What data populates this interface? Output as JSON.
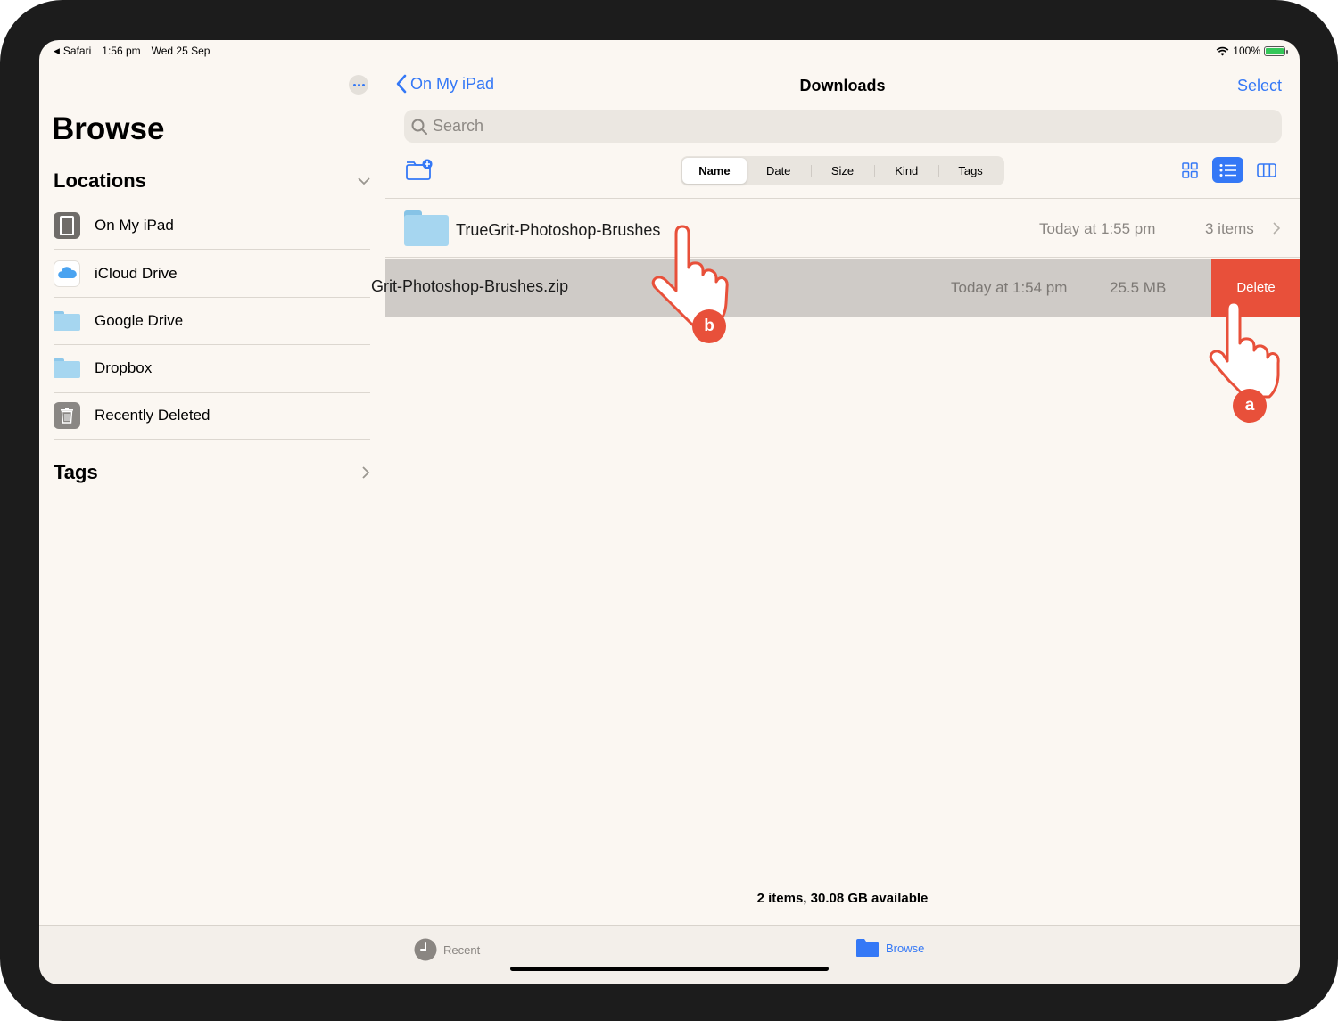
{
  "status_bar": {
    "app_back": "Safari",
    "time": "1:56 pm",
    "date": "Wed 25 Sep",
    "battery": "100%"
  },
  "sidebar": {
    "title": "Browse",
    "locations_header": "Locations",
    "locations": [
      {
        "label": "On My iPad",
        "icon": "ipad-icon"
      },
      {
        "label": "iCloud Drive",
        "icon": "icloud-icon"
      },
      {
        "label": "Google Drive",
        "icon": "folder-icon"
      },
      {
        "label": "Dropbox",
        "icon": "folder-icon"
      },
      {
        "label": "Recently Deleted",
        "icon": "trash-icon"
      }
    ],
    "tags_header": "Tags"
  },
  "nav": {
    "back_label": "On My iPad",
    "title": "Downloads",
    "select_label": "Select"
  },
  "search": {
    "placeholder": "Search"
  },
  "sort_options": [
    "Name",
    "Date",
    "Size",
    "Kind",
    "Tags"
  ],
  "sort_selected": "Name",
  "files": [
    {
      "name": "TrueGrit-Photoshop-Brushes",
      "date": "Today at 1:55 pm",
      "size": "3 items",
      "type": "folder"
    },
    {
      "name": "Grit-Photoshop-Brushes.zip",
      "date": "Today at 1:54 pm",
      "size": "25.5 MB",
      "type": "zip",
      "swiped": true
    }
  ],
  "delete_label": "Delete",
  "footer": "2 items, 30.08 GB available",
  "tabbar": {
    "recent_label": "Recent",
    "browse_label": "Browse"
  },
  "callouts": {
    "a": "a",
    "b": "b"
  },
  "colors": {
    "accent": "#3478f6",
    "delete": "#e8503a",
    "background": "#fbf7f2"
  }
}
